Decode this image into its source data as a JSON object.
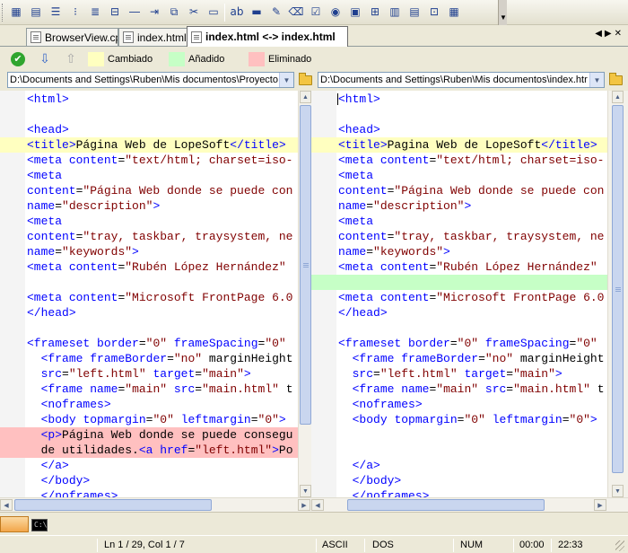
{
  "toolbar": {
    "buttons": [
      "table-icon",
      "grid-icon",
      "numbered-list-icon",
      "bullet-list-icon",
      "ordered-list-icon",
      "strikethrough-icon",
      "horizontal-rule-icon",
      "indent-icon",
      "copy-icon",
      "cut-icon",
      "form-icon",
      "rename-field-icon",
      "textbox-icon",
      "pencil-icon",
      "eraser-icon",
      "checkbox-icon",
      "radio-icon",
      "label-icon",
      "table-grid-icon",
      "image-list-icon",
      "listbox-icon",
      "frame-icon",
      "more-icon"
    ]
  },
  "tabs": [
    {
      "label": "BrowserView.cpp",
      "active": false
    },
    {
      "label": "index.html",
      "active": false
    },
    {
      "label": "index.html <-> index.html",
      "active": true
    }
  ],
  "legend": {
    "changed": "Cambiado",
    "added": "Añadido",
    "removed": "Eliminado",
    "colors": {
      "changed": "#ffffc0",
      "added": "#c6ffc6",
      "removed": "#ffc0c0"
    }
  },
  "left_pane": {
    "path": "D:\\Documents and Settings\\Ruben\\Mis documentos\\Proyecto"
  },
  "right_pane": {
    "path": "D:\\Documents and Settings\\Ruben\\Mis documentos\\index.htr"
  },
  "left_lines": [
    {
      "text": "<html>",
      "state": ""
    },
    {
      "text": "",
      "state": ""
    },
    {
      "text": "<head>",
      "state": ""
    },
    {
      "text": "<title>Página Web de LopeSoft</title>",
      "state": "changed"
    },
    {
      "text": "<meta content=\"text/html; charset=iso-",
      "state": ""
    },
    {
      "text": "<meta",
      "state": ""
    },
    {
      "text": "content=\"Página Web donde se puede con",
      "state": ""
    },
    {
      "text": "name=\"description\">",
      "state": ""
    },
    {
      "text": "<meta",
      "state": ""
    },
    {
      "text": "content=\"tray, taskbar, traysystem, ne",
      "state": ""
    },
    {
      "text": "name=\"keywords\">",
      "state": ""
    },
    {
      "text": "<meta content=\"Rubén López Hernández\"",
      "state": ""
    },
    {
      "text": "",
      "state": ""
    },
    {
      "text": "<meta content=\"Microsoft FrontPage 6.0",
      "state": ""
    },
    {
      "text": "</head>",
      "state": ""
    },
    {
      "text": "",
      "state": ""
    },
    {
      "text": "<frameset border=\"0\" frameSpacing=\"0\"",
      "state": ""
    },
    {
      "text": "  <frame frameBorder=\"no\" marginHeight",
      "state": ""
    },
    {
      "text": "  src=\"left.html\" target=\"main\">",
      "state": ""
    },
    {
      "text": "  <frame name=\"main\" src=\"main.html\" t",
      "state": ""
    },
    {
      "text": "  <noframes>",
      "state": ""
    },
    {
      "text": "  <body topmargin=\"0\" leftmargin=\"0\">",
      "state": ""
    },
    {
      "text": "  <p>Página Web donde se puede consegu",
      "state": "removed"
    },
    {
      "text": "  de utilidades.<a href=\"left.html\">Po",
      "state": "removed"
    },
    {
      "text": "  </a>",
      "state": ""
    },
    {
      "text": "  </body>",
      "state": ""
    },
    {
      "text": "  </noframes>",
      "state": ""
    }
  ],
  "right_lines": [
    {
      "text": "<html>",
      "state": ""
    },
    {
      "text": "",
      "state": ""
    },
    {
      "text": "<head>",
      "state": ""
    },
    {
      "text": "<title>Pagina Web de LopeSoft</title>",
      "state": "changed"
    },
    {
      "text": "<meta content=\"text/html; charset=iso-",
      "state": ""
    },
    {
      "text": "<meta",
      "state": ""
    },
    {
      "text": "content=\"Página Web donde se puede con",
      "state": ""
    },
    {
      "text": "name=\"description\">",
      "state": ""
    },
    {
      "text": "<meta",
      "state": ""
    },
    {
      "text": "content=\"tray, taskbar, traysystem, ne",
      "state": ""
    },
    {
      "text": "name=\"keywords\">",
      "state": ""
    },
    {
      "text": "<meta content=\"Rubén López Hernández\"",
      "state": ""
    },
    {
      "text": "",
      "state": "added"
    },
    {
      "text": "<meta content=\"Microsoft FrontPage 6.0",
      "state": ""
    },
    {
      "text": "</head>",
      "state": ""
    },
    {
      "text": "",
      "state": ""
    },
    {
      "text": "<frameset border=\"0\" frameSpacing=\"0\"",
      "state": ""
    },
    {
      "text": "  <frame frameBorder=\"no\" marginHeight",
      "state": ""
    },
    {
      "text": "  src=\"left.html\" target=\"main\">",
      "state": ""
    },
    {
      "text": "  <frame name=\"main\" src=\"main.html\" t",
      "state": ""
    },
    {
      "text": "  <noframes>",
      "state": ""
    },
    {
      "text": "  <body topmargin=\"0\" leftmargin=\"0\">",
      "state": ""
    },
    {
      "text": "",
      "state": ""
    },
    {
      "text": "",
      "state": ""
    },
    {
      "text": "  </a>",
      "state": ""
    },
    {
      "text": "  </body>",
      "state": ""
    },
    {
      "text": "  </noframes>",
      "state": ""
    }
  ],
  "status": {
    "position": "Ln 1 / 29, Col 1 / 7",
    "encoding": "ASCII",
    "line_endings": "DOS",
    "num_lock": "NUM",
    "elapsed": "00:00",
    "clock": "22:33"
  }
}
